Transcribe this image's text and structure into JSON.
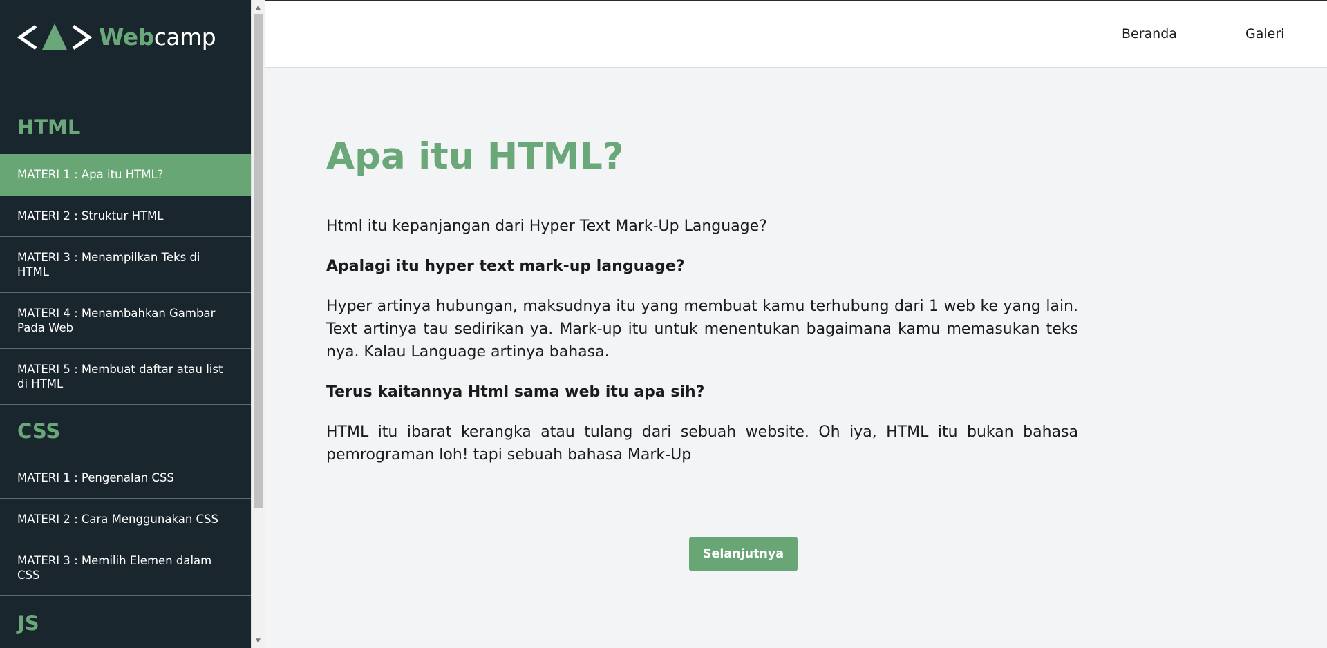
{
  "brand": {
    "logo_icon": "code-mountain-logo",
    "name_web": "Web",
    "name_camp": "camp",
    "colors": {
      "accent": "#6aa87a",
      "sidebar_bg": "#1a262e",
      "active_bg": "#68a676"
    }
  },
  "sidebar": {
    "sections": [
      {
        "title": "HTML",
        "items": [
          {
            "label": "MATERI 1 : Apa itu HTML?",
            "active": true
          },
          {
            "label": "MATERI 2 : Struktur HTML"
          },
          {
            "label": "MATERI 3 : Menampilkan Teks di HTML"
          },
          {
            "label": "MATERI 4 : Menambahkan Gambar Pada Web"
          },
          {
            "label": "MATERI 5 : Membuat daftar atau list di HTML"
          }
        ]
      },
      {
        "title": "CSS",
        "items": [
          {
            "label": "MATERI 1 : Pengenalan CSS"
          },
          {
            "label": "MATERI 2 : Cara Menggunakan CSS"
          },
          {
            "label": "MATERI 3 : Memilih Elemen dalam CSS"
          }
        ]
      },
      {
        "title": "JS",
        "items": []
      }
    ]
  },
  "topnav": {
    "links": [
      "Beranda",
      "Galeri"
    ]
  },
  "main": {
    "title": "Apa itu HTML?",
    "paragraphs": [
      {
        "text": "Html itu kepanjangan dari Hyper Text Mark-Up Language?",
        "bold": false
      },
      {
        "text": "Apalagi itu hyper text mark-up language?",
        "bold": true
      },
      {
        "text": "Hyper artinya hubungan, maksudnya itu yang membuat kamu terhubung dari 1 web ke yang lain. Text artinya tau sedirikan ya. Mark-up itu untuk menentukan bagaimana kamu memasukan teks nya. Kalau Language artinya bahasa.",
        "bold": false
      },
      {
        "text": "Terus kaitannya Html sama web itu apa sih?",
        "bold": true
      },
      {
        "text": "HTML itu ibarat kerangka atau tulang dari sebuah website. Oh iya, HTML itu bukan bahasa pemrograman loh! tapi sebuah bahasa Mark-Up",
        "bold": false
      }
    ],
    "next_button": "Selanjutnya"
  }
}
